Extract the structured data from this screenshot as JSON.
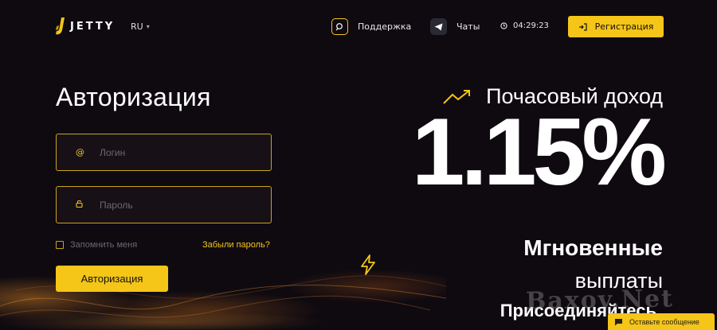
{
  "header": {
    "logo_text": "JETTY",
    "language": "RU",
    "support_label": "Поддержка",
    "chats_label": "Чаты",
    "time": "04:29:23",
    "register_label": "Регистрация"
  },
  "login": {
    "title": "Авторизация",
    "login_placeholder": "Логин",
    "password_placeholder": "Пароль",
    "remember_label": "Запомнить меня",
    "forgot_label": "Забыли пароль?",
    "submit_label": "Авторизация"
  },
  "promo": {
    "subtitle": "Почасовый доход",
    "rate": "1.15%",
    "instant": "Мгновенные",
    "payouts": "выплаты",
    "join": "Присоединяйтесь"
  },
  "watermark": "Baxov.Net",
  "chat_widget": {
    "label": "Оставьте сообщение"
  },
  "colors": {
    "accent": "#f5c518",
    "background": "#0f0a10"
  },
  "icons": {
    "support": "search-icon",
    "chats": "telegram-icon",
    "clock": "clock-icon",
    "register": "login-arrow-icon",
    "login_field": "at-icon",
    "password_field": "lock-icon",
    "promo": "trend-up-icon",
    "payouts": "lightning-icon",
    "chat": "chat-bubble-icon"
  }
}
